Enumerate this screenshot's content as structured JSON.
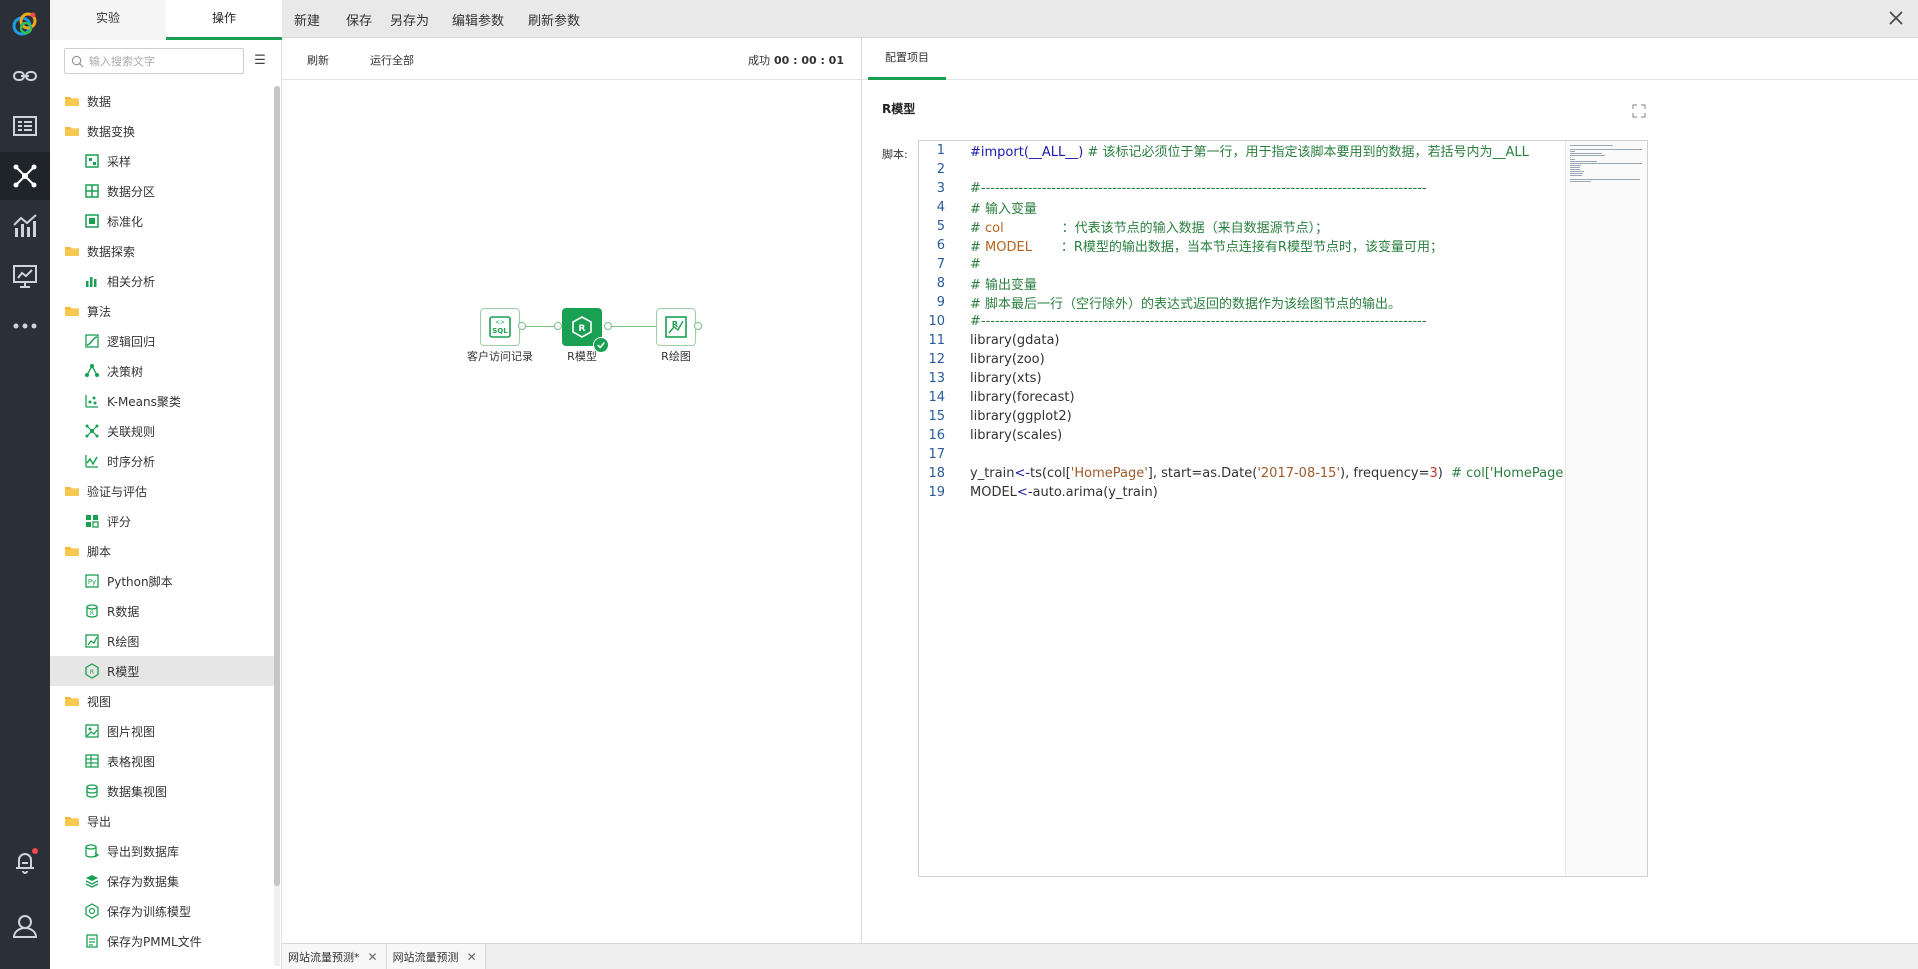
{
  "nav": {
    "tabs": [
      {
        "label": "实验",
        "active": false
      },
      {
        "label": "操作",
        "active": true
      }
    ],
    "search_placeholder": "输入搜索文字",
    "tree": [
      {
        "type": "folder",
        "label": "数据",
        "icon": "folder-icon"
      },
      {
        "type": "folder",
        "label": "数据变换",
        "icon": "folder-open-icon"
      },
      {
        "type": "leaf",
        "label": "采样",
        "icon": "sample-icon"
      },
      {
        "type": "leaf",
        "label": "数据分区",
        "icon": "partition-icon"
      },
      {
        "type": "leaf",
        "label": "标准化",
        "icon": "normalize-icon"
      },
      {
        "type": "folder",
        "label": "数据探索",
        "icon": "folder-open-icon"
      },
      {
        "type": "leaf",
        "label": "相关分析",
        "icon": "correlation-icon"
      },
      {
        "type": "folder",
        "label": "算法",
        "icon": "folder-open-icon"
      },
      {
        "type": "leaf",
        "label": "逻辑回归",
        "icon": "logistic-icon"
      },
      {
        "type": "leaf",
        "label": "决策树",
        "icon": "decision-tree-icon"
      },
      {
        "type": "leaf",
        "label": "K-Means聚类",
        "icon": "kmeans-icon"
      },
      {
        "type": "leaf",
        "label": "关联规则",
        "icon": "association-icon"
      },
      {
        "type": "leaf",
        "label": "时序分析",
        "icon": "timeseries-icon"
      },
      {
        "type": "folder",
        "label": "验证与评估",
        "icon": "folder-open-icon"
      },
      {
        "type": "leaf",
        "label": "评分",
        "icon": "score-icon"
      },
      {
        "type": "folder",
        "label": "脚本",
        "icon": "folder-open-icon"
      },
      {
        "type": "leaf",
        "label": "Python脚本",
        "icon": "python-script-icon"
      },
      {
        "type": "leaf",
        "label": "R数据",
        "icon": "r-data-icon"
      },
      {
        "type": "leaf",
        "label": "R绘图",
        "icon": "r-plot-icon"
      },
      {
        "type": "leaf",
        "label": "R模型",
        "icon": "r-model-icon",
        "active": true
      },
      {
        "type": "folder",
        "label": "视图",
        "icon": "folder-open-icon"
      },
      {
        "type": "leaf",
        "label": "图片视图",
        "icon": "image-view-icon"
      },
      {
        "type": "leaf",
        "label": "表格视图",
        "icon": "table-view-icon"
      },
      {
        "type": "leaf",
        "label": "数据集视图",
        "icon": "dataset-view-icon"
      },
      {
        "type": "folder",
        "label": "导出",
        "icon": "folder-open-icon"
      },
      {
        "type": "leaf",
        "label": "导出到数据库",
        "icon": "export-db-icon"
      },
      {
        "type": "leaf",
        "label": "保存为数据集",
        "icon": "save-dataset-icon"
      },
      {
        "type": "leaf",
        "label": "保存为训练模型",
        "icon": "save-model-icon"
      },
      {
        "type": "leaf",
        "label": "保存为PMML文件",
        "icon": "save-pmml-icon"
      }
    ]
  },
  "toolbar": {
    "new_label": "新建",
    "save_label": "保存",
    "save_as_label": "另存为",
    "edit_params_label": "编辑参数",
    "refresh_params_label": "刷新参数"
  },
  "canvas": {
    "refresh_label": "刷新",
    "run_all_label": "运行全部",
    "status_label": "成功",
    "status_time": "00 : 00 : 01",
    "nodes": [
      {
        "label": "客户访问记录",
        "icon": "sql-icon"
      },
      {
        "label": "R模型",
        "icon": "r-model-icon",
        "selected": true
      },
      {
        "label": "R绘图",
        "icon": "r-plot-icon"
      }
    ]
  },
  "config": {
    "tab_label": "配置项目",
    "node_title": "R模型",
    "script_label": "脚本:",
    "code_lines": [
      [
        {
          "t": "#import(__ALL__)",
          "c": "kw"
        },
        {
          "t": " # 该标记必须位于第一行，用于指定该脚本要用到的数据，若括号内为__ALL",
          "c": "cm"
        }
      ],
      [],
      [
        {
          "t": "#-----------------------------------------------------------------------------------------------",
          "c": "cm"
        }
      ],
      [
        {
          "t": "# 输入变量",
          "c": "cm"
        }
      ],
      [
        {
          "t": "# ",
          "c": "cm"
        },
        {
          "t": "col",
          "c": "var"
        },
        {
          "t": "              ：代表该节点的输入数据（来自数据源节点）；",
          "c": "cm"
        }
      ],
      [
        {
          "t": "# ",
          "c": "cm"
        },
        {
          "t": "MODEL",
          "c": "var"
        },
        {
          "t": "       ：R模型的输出数据，当本节点连接有R模型节点时，该变量可用；",
          "c": "cm"
        }
      ],
      [
        {
          "t": "#",
          "c": "cm"
        }
      ],
      [
        {
          "t": "# 输出变量",
          "c": "cm"
        }
      ],
      [
        {
          "t": "# 脚本最后一行（空行除外）的表达式返回的数据作为该绘图节点的输出。",
          "c": "cm"
        }
      ],
      [
        {
          "t": "#-----------------------------------------------------------------------------------------------",
          "c": "cm"
        }
      ],
      [
        {
          "t": "library(gdata)",
          "c": ""
        }
      ],
      [
        {
          "t": "library(zoo)",
          "c": ""
        }
      ],
      [
        {
          "t": "library(xts)",
          "c": ""
        }
      ],
      [
        {
          "t": "library(forecast)",
          "c": ""
        }
      ],
      [
        {
          "t": "library(ggplot2)",
          "c": ""
        }
      ],
      [
        {
          "t": "library(scales)",
          "c": ""
        }
      ],
      [],
      [
        {
          "t": "y_train",
          "c": ""
        },
        {
          "t": "<-",
          "c": "kw"
        },
        {
          "t": "ts(col[",
          "c": ""
        },
        {
          "t": "'HomePage'",
          "c": "str"
        },
        {
          "t": "], start=as.Date(",
          "c": ""
        },
        {
          "t": "'2017-08-15'",
          "c": "str"
        },
        {
          "t": "), frequency=",
          "c": ""
        },
        {
          "t": "3",
          "c": "num"
        },
        {
          "t": ")  ",
          "c": ""
        },
        {
          "t": "# col['HomePage",
          "c": "cm"
        }
      ],
      [
        {
          "t": "MODEL",
          "c": ""
        },
        {
          "t": "<-",
          "c": "kw"
        },
        {
          "t": "auto.arima(y_train)",
          "c": ""
        }
      ]
    ]
  },
  "bottom_tabs": [
    {
      "label": "网站流量预测*"
    },
    {
      "label": "网站流量预测"
    }
  ],
  "colors": {
    "accent": "#1aa052",
    "rail_bg": "#2b3038"
  }
}
